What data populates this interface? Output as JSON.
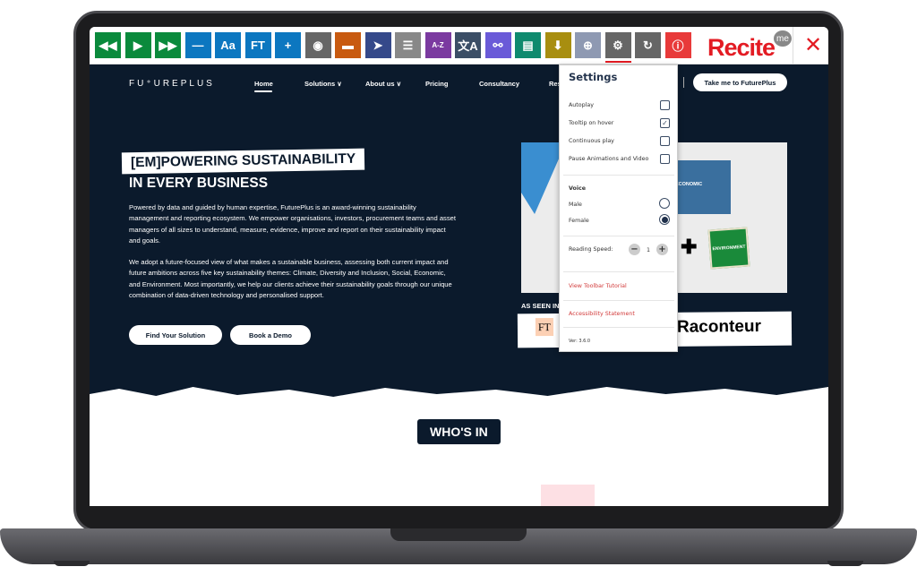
{
  "toolbar": {
    "buttons": [
      {
        "name": "rewind-icon",
        "glyph": "◀◀",
        "color": "#0a8a3c"
      },
      {
        "name": "play-icon",
        "glyph": "▶",
        "color": "#0a8a3c"
      },
      {
        "name": "fast-forward-icon",
        "glyph": "▶▶",
        "color": "#0a8a3c"
      },
      {
        "name": "decrease-text-icon",
        "glyph": "—",
        "color": "#0c77c0"
      },
      {
        "name": "font-icon",
        "glyph": "Aa",
        "color": "#0c77c0"
      },
      {
        "name": "font-type-icon",
        "glyph": "FT",
        "color": "#0c77c0"
      },
      {
        "name": "increase-text-icon",
        "glyph": "+",
        "color": "#0c77c0"
      },
      {
        "name": "color-wheel-icon",
        "glyph": "◉",
        "color": "#666666"
      },
      {
        "name": "ruler-icon",
        "glyph": "▬",
        "color": "#c85a10"
      },
      {
        "name": "cursor-icon",
        "glyph": "➤",
        "color": "#35498a"
      },
      {
        "name": "screen-mask-icon",
        "glyph": "☰",
        "color": "#888888"
      },
      {
        "name": "dictionary-icon",
        "glyph": "A-Z",
        "color": "#7b3aa0"
      },
      {
        "name": "translate-icon",
        "glyph": "文A",
        "color": "#3b4e66"
      },
      {
        "name": "glasses-icon",
        "glyph": "⚯",
        "color": "#6a5ad8"
      },
      {
        "name": "text-only-icon",
        "glyph": "▤",
        "color": "#0f8a6e"
      },
      {
        "name": "download-icon",
        "glyph": "⬇",
        "color": "#a88e10"
      },
      {
        "name": "magnifier-icon",
        "glyph": "⊕",
        "color": "#8e99b2"
      },
      {
        "name": "settings-gear-icon",
        "glyph": "⚙",
        "color": "#666666"
      },
      {
        "name": "reset-icon",
        "glyph": "↻",
        "color": "#666666"
      },
      {
        "name": "info-icon",
        "glyph": "ⓘ",
        "color": "#e83a3a"
      }
    ],
    "brand": "Recite",
    "brand_badge": "me",
    "close": "✕"
  },
  "site": {
    "logo": "FU⁺UREPLUS",
    "nav": [
      "Home",
      "Solutions ∨",
      "About us ∨",
      "Pricing",
      "Consultancy",
      "Res"
    ],
    "cta": "Take me to FuturePlus",
    "hero_line1": "[EM]POWERING SUSTAINABILITY",
    "hero_line2": "IN EVERY BUSINESS",
    "para1": "Powered by data and guided by human expertise, FuturePlus is an award-winning sustainability management and reporting ecosystem. We empower organisations, investors, procurement teams and asset managers of all sizes to understand, measure, evidence, improve and report on their sustainability impact and goals.",
    "para2": "We adopt a future-focused view of what makes a sustainable business, assessing both current impact and future ambitions across five key sustainability themes: Climate, Diversity and Inclusion, Social, Economic, and Environment. Most importantly, we help our clients achieve their sustainability goals through our unique combination of data-driven technology and personalised support.",
    "btn1": "Find Your Solution",
    "btn2": "Book a Demo",
    "img_labels": [
      "ECONOMIC",
      "ENVIRONMENT"
    ],
    "seen": "AS SEEN IN",
    "press": [
      "FT",
      "Raconteur"
    ],
    "whos_in": "WHO'S IN"
  },
  "settings": {
    "title": "Settings",
    "options": [
      {
        "label": "Autoplay",
        "checked": false
      },
      {
        "label": "Tooltip on hover",
        "checked": true
      },
      {
        "label": "Continuous play",
        "checked": false
      },
      {
        "label": "Pause Animations and Video",
        "checked": false
      }
    ],
    "voice_label": "Voice",
    "voices": [
      {
        "label": "Male",
        "selected": false
      },
      {
        "label": "Female",
        "selected": true
      }
    ],
    "speed_label": "Reading Speed:",
    "speed": "1",
    "minus": "−",
    "plus": "+",
    "tutorial": "View Toolbar Tutorial",
    "statement": "Accessibility Statement",
    "version": "Ver: 3.6.0"
  }
}
